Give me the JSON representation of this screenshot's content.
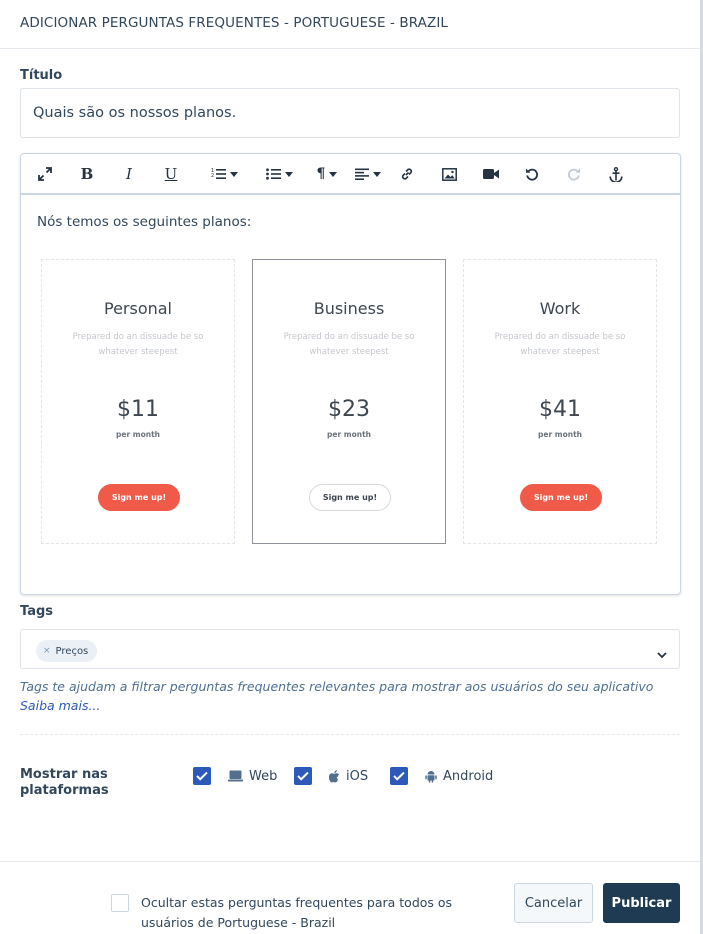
{
  "header": {
    "title": "ADICIONAR PERGUNTAS FREQUENTES - PORTUGUESE - BRAZIL"
  },
  "title_field": {
    "label": "Título",
    "value": "Quais são os nossos planos."
  },
  "toolbar": {
    "icons": [
      "fullscreen-icon",
      "bold-icon",
      "italic-icon",
      "underline-icon",
      "ordered-list-icon",
      "unordered-list-icon",
      "paragraph-icon",
      "align-icon",
      "link-icon",
      "image-icon",
      "video-icon",
      "undo-icon",
      "redo-icon",
      "anchor-icon"
    ],
    "bold": "B",
    "italic": "I",
    "underline": "U",
    "paragraph": "¶"
  },
  "editor": {
    "intro": "Nós temos os seguintes planos:",
    "plans": [
      {
        "name": "Personal",
        "description": "Prepared do an dissuade be so whatever steepest",
        "price": "$11",
        "period": "per month",
        "button": "Sign me up!",
        "featured": false
      },
      {
        "name": "Business",
        "description": "Prepared do an dissuade be so whatever steepest",
        "price": "$23",
        "period": "per month",
        "button": "Sign me up!",
        "featured": true
      },
      {
        "name": "Work",
        "description": "Prepared do an dissuade be so whatever steepest",
        "price": "$41",
        "period": "per month",
        "button": "Sign me up!",
        "featured": false
      }
    ]
  },
  "tags": {
    "label": "Tags",
    "items": [
      "Preços"
    ],
    "remove_glyph": "×",
    "help": "Tags te ajudam a filtrar perguntas frequentes relevantes para mostrar aos usuários do seu aplicativo",
    "help_link": "Saiba mais..."
  },
  "platforms": {
    "label": "Mostrar nas plataformas",
    "items": [
      {
        "label": "Web",
        "icon": "desktop-icon",
        "checked": true
      },
      {
        "label": "iOS",
        "icon": "apple-icon",
        "checked": true
      },
      {
        "label": "Android",
        "icon": "android-icon",
        "checked": true
      }
    ]
  },
  "footer": {
    "hide_text": "Ocultar estas perguntas frequentes para todos os usuários de Portuguese - Brazil",
    "hide_checked": false,
    "cancel_label": "Cancelar",
    "publish_label": "Publicar"
  },
  "colors": {
    "accent": "#2d59b8",
    "primary_button": "#1f3b53",
    "plan_button": "#f05a48",
    "text": "#33475b"
  }
}
